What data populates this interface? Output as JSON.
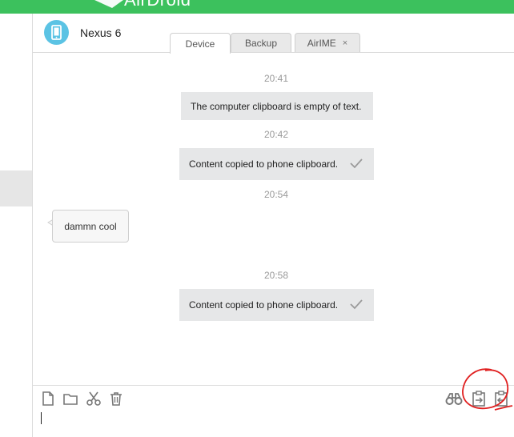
{
  "app": {
    "title": "AirDroid"
  },
  "device": {
    "name": "Nexus 6"
  },
  "tabs": [
    {
      "label": "Device",
      "active": true
    },
    {
      "label": "Backup",
      "active": false
    },
    {
      "label": "AirIME",
      "active": false,
      "closable": true
    }
  ],
  "messages": [
    {
      "time": "20:41",
      "text": "The computer clipboard is empty of text.",
      "type": "system",
      "checked": false
    },
    {
      "time": "20:42",
      "text": "Content copied to phone clipboard.",
      "type": "system",
      "checked": true
    },
    {
      "time": "20:54",
      "text": "dammn cool",
      "type": "incoming"
    },
    {
      "time": "20:58",
      "text": "Content copied to phone clipboard.",
      "type": "system",
      "checked": true
    }
  ],
  "toolbar": {
    "left": [
      "new-file-icon",
      "folder-icon",
      "scissors-icon",
      "trash-icon"
    ],
    "right": [
      "binoculars-icon",
      "clipboard-to-phone-icon",
      "clipboard-from-phone-icon"
    ]
  },
  "colors": {
    "brand": "#3cc15d",
    "device_icon": "#5bc3e4",
    "annotation": "#e02020"
  },
  "close_symbol": "×"
}
